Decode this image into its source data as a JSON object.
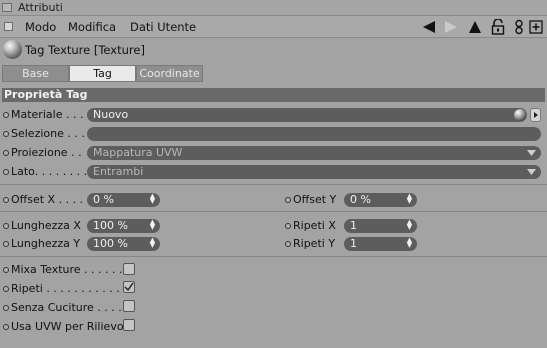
{
  "window": {
    "title": "Attributi"
  },
  "menu": {
    "items": [
      "Modo",
      "Modifica",
      "Dati Utente"
    ]
  },
  "object": {
    "title": "Tag Texture [Texture]"
  },
  "tabs": [
    {
      "label": "Base",
      "active": false
    },
    {
      "label": "Tag",
      "active": true
    },
    {
      "label": "Coordinate",
      "active": false
    }
  ],
  "section": {
    "title": "Proprietà Tag"
  },
  "fields": {
    "materiale": {
      "label": "Materiale . . .",
      "value": "Nuovo"
    },
    "selezione": {
      "label": "Selezione . . .",
      "value": ""
    },
    "proiezione": {
      "label": "Proiezione . .",
      "value": "Mappatura UVW"
    },
    "lato": {
      "label": "Lato. . . . . . . .",
      "value": "Entrambi"
    },
    "offset_x": {
      "label": "Offset X . . . .",
      "value": "0 %"
    },
    "offset_y": {
      "label": "Offset Y",
      "value": "0 %"
    },
    "lunghezza_x": {
      "label": "Lunghezza X",
      "value": "100 %"
    },
    "lunghezza_y": {
      "label": "Lunghezza Y",
      "value": "100 %"
    },
    "ripeti_x": {
      "label": "Ripeti X",
      "value": "1"
    },
    "ripeti_y": {
      "label": "Ripeti Y",
      "value": "1"
    }
  },
  "checkboxes": {
    "mixa_texture": {
      "label": "Mixa Texture . . . . . .",
      "checked": false
    },
    "ripeti": {
      "label": "Ripeti . . . . . . . . . . . .",
      "checked": true
    },
    "senza_cuciture": {
      "label": "Senza Cuciture . . . .",
      "checked": false
    },
    "usa_uvw": {
      "label": "Usa UVW per Rilievo",
      "checked": false
    }
  },
  "toolbar_icons": [
    "arrow-left-icon",
    "arrow-right-icon",
    "arrow-up-icon",
    "lock-icon",
    "link-icon",
    "add-icon"
  ]
}
